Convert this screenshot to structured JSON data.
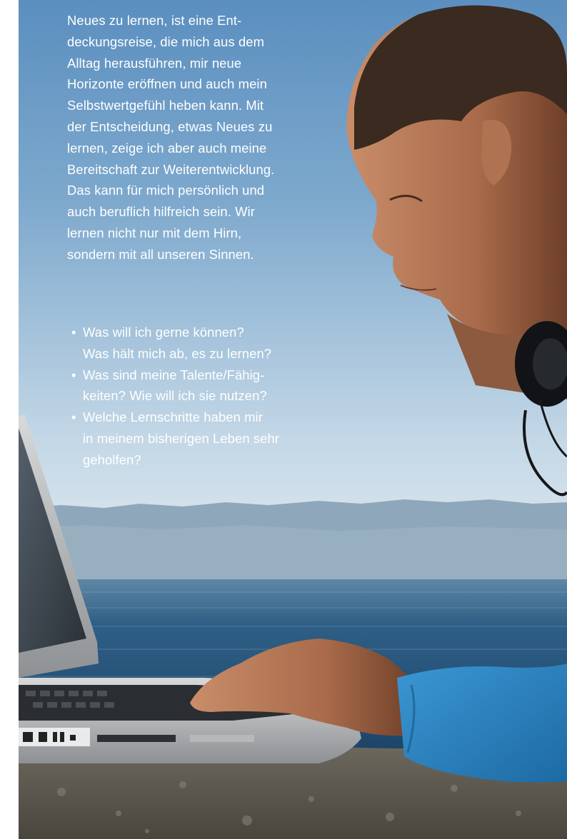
{
  "intro_lines": [
    "Neues zu lernen, ist eine Ent-",
    "deckungsreise, die mich aus dem",
    "Alltag herausführen, mir neue",
    "Horizonte eröffnen und auch mein",
    "Selbstwertgefühl heben kann. Mit",
    "der Entscheidung, etwas Neues zu",
    "lernen, zeige ich aber auch meine",
    "Bereitschaft zur Weiterentwicklung.",
    "Das kann für mich persönlich und",
    "auch beruflich hilfreich sein. Wir",
    "lernen nicht nur mit dem Hirn,",
    "sondern mit all unseren Sinnen."
  ],
  "questions": [
    {
      "lines": [
        "Was will ich gerne können?",
        "Was hält mich ab, es zu lernen?"
      ]
    },
    {
      "lines": [
        "Was sind meine Talente/Fähig-",
        "keiten? Wie will ich sie nutzen?"
      ]
    },
    {
      "lines": [
        "Welche Lernschritte haben mir",
        "in meinem bisherigen Leben sehr",
        "geholfen?"
      ]
    }
  ],
  "bullet_symbol": "•",
  "colors": {
    "sky_top": "#5c8fbd",
    "sky_bottom": "#dfe9f0",
    "sea": "#2e5f85",
    "sweater": "#2b83c0",
    "text": "#ffffff"
  }
}
